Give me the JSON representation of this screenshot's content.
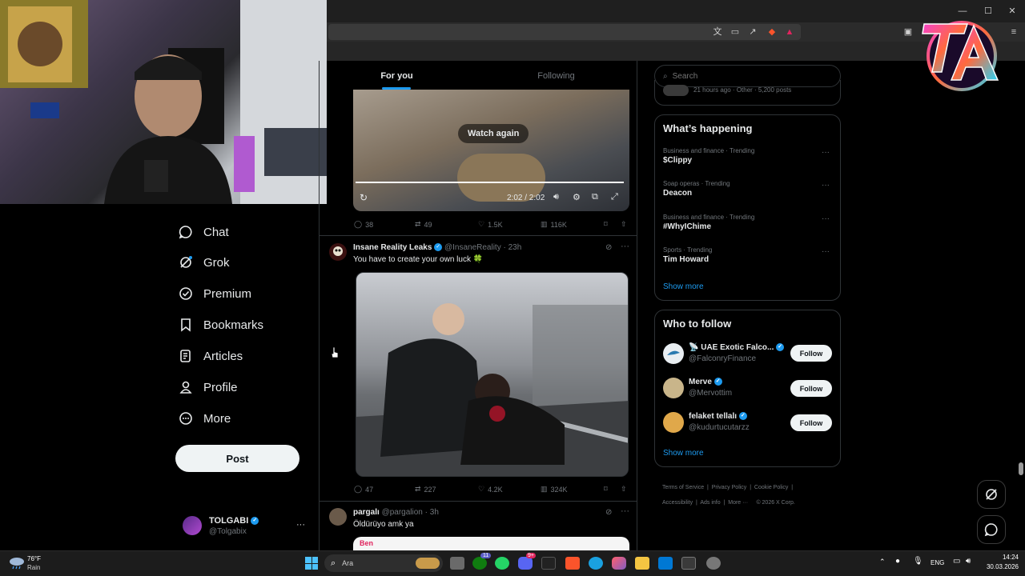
{
  "browser": {
    "window_controls": {
      "minimize": "—",
      "maximize": "☐",
      "close": "✕"
    }
  },
  "colors": {
    "accent": "#1d9bf0",
    "background": "#000000",
    "border": "#2f3336",
    "muted_text": "#71767b",
    "live_red": "#e0245e"
  },
  "nav": {
    "items": [
      {
        "label": "Chat",
        "icon": "chat-bubble-icon"
      },
      {
        "label": "Grok",
        "icon": "grok-icon"
      },
      {
        "label": "Premium",
        "icon": "premium-verified-icon"
      },
      {
        "label": "Bookmarks",
        "icon": "bookmark-icon"
      },
      {
        "label": "Articles",
        "icon": "articles-icon"
      },
      {
        "label": "Profile",
        "icon": "person-icon"
      },
      {
        "label": "More",
        "icon": "more-circle-icon"
      }
    ],
    "post_label": "Post",
    "account": {
      "name": "TOLGABI",
      "handle": "@Tolgabix",
      "menu": "···"
    }
  },
  "feed": {
    "tabs": [
      {
        "label": "For you",
        "active": true
      },
      {
        "label": "Following",
        "active": false
      }
    ],
    "video_player": {
      "watch_again_label": "Watch again",
      "time": "2:02 / 2:02",
      "progress": 1.0
    },
    "post1_metrics": {
      "replies": "38",
      "reposts": "49",
      "likes": "1.5K",
      "views": "116K"
    },
    "post2": {
      "author": "Insane Reality Leaks",
      "handle": "@InsaneReality",
      "time": "23h",
      "text": "You have to create your own luck 🍀",
      "metrics": {
        "replies": "47",
        "reposts": "227",
        "likes": "4.2K",
        "views": "324K"
      }
    },
    "post3": {
      "author": "pargalı",
      "handle": "@pargalion",
      "time": "3h",
      "text": "Öldürüyo amk ya",
      "preview_text": "Ben"
    }
  },
  "sidebar": {
    "search_placeholder": "Search",
    "partial_card_text": "21 hours ago · Other · 5,200 posts",
    "whats_happening": {
      "title": "What’s happening",
      "trends": [
        {
          "meta": "Business and finance · Trending",
          "name": "$Clippy"
        },
        {
          "meta": "Soap operas · Trending",
          "name": "Deacon"
        },
        {
          "meta": "Business and finance · Trending",
          "name": "#WhyIChime"
        },
        {
          "meta": "Sports · Trending",
          "name": "Tim Howard"
        }
      ],
      "show_more": "Show more"
    },
    "who_to_follow": {
      "title": "Who to follow",
      "accounts": [
        {
          "name": "📡 UAE Exotic Falco...",
          "handle": "@FalconryFinance",
          "button": "Follow"
        },
        {
          "name": "Merve",
          "handle": "@Mervottim",
          "button": "Follow"
        },
        {
          "name": "felaket tellalı",
          "handle": "@kudurtucutarzz",
          "button": "Follow"
        }
      ],
      "show_more": "Show more"
    },
    "footer": {
      "links": [
        "Terms of Service",
        "Privacy Policy",
        "Cookie Policy",
        "Accessibility",
        "Ads info",
        "More ···",
        "© 2026 X Corp."
      ]
    }
  },
  "taskbar": {
    "weather_temp": "76°F",
    "weather_desc": "Rain",
    "search_label": "Ara",
    "language": "ENG",
    "time": "14:24",
    "date": "30.03.2026",
    "badges": {
      "teams": "11",
      "discord": "9+"
    }
  }
}
